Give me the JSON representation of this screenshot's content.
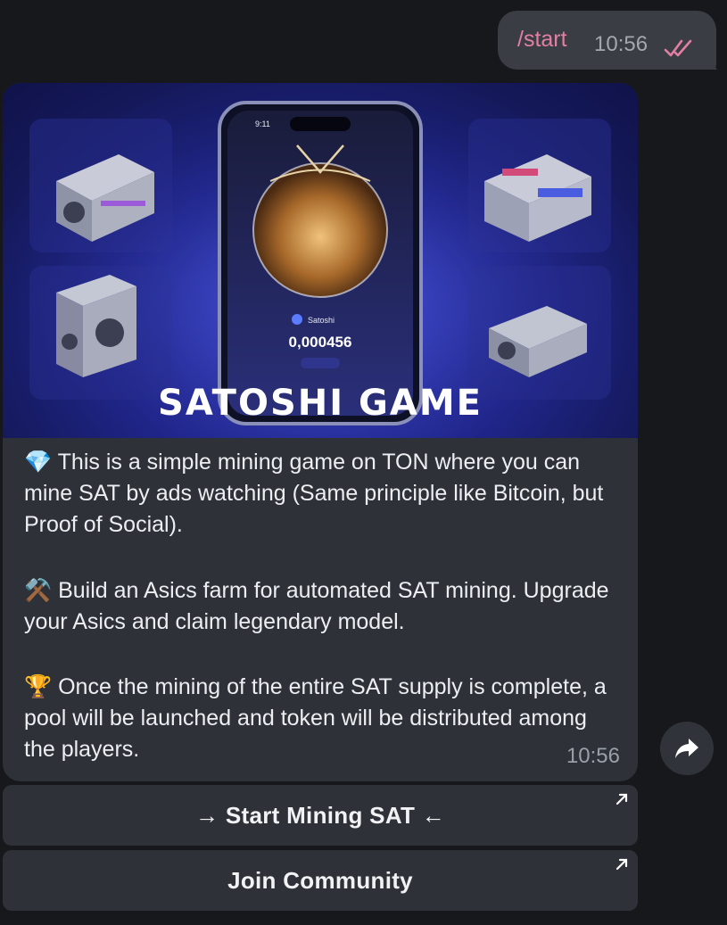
{
  "outgoing": {
    "command": "/start",
    "time": "10:56",
    "status_icon": "double-check-icon"
  },
  "incoming": {
    "banner": {
      "phone_time": "9:11",
      "username": "Satoshi",
      "balance": "0,000456",
      "title": "SATOSHI GAME"
    },
    "paragraphs": [
      {
        "icon": "💎",
        "icon_name": "gem-icon",
        "text": "This is a simple mining game on TON where you can mine SAT by ads watching (Same principle like Bitcoin, but Proof of Social)."
      },
      {
        "icon": "⚒️",
        "icon_name": "hammer-pick-icon",
        "text": "Build an Asics farm for automated SAT mining. Upgrade your Asics and claim legendary model."
      },
      {
        "icon": "🏆",
        "icon_name": "trophy-icon",
        "text": "Once the mining of the entire SAT supply is complete, a pool will be launched and token will be distributed among the players."
      }
    ],
    "time": "10:56"
  },
  "buttons": {
    "start_mining": "→ Start Mining SAT ←",
    "join_community": "Join Community"
  },
  "colors": {
    "background": "#16181c",
    "bubble": "#2e3138",
    "outgoing_bubble": "#3a3d44",
    "command": "#e37fa3",
    "banner_blue": "#1f2589"
  }
}
